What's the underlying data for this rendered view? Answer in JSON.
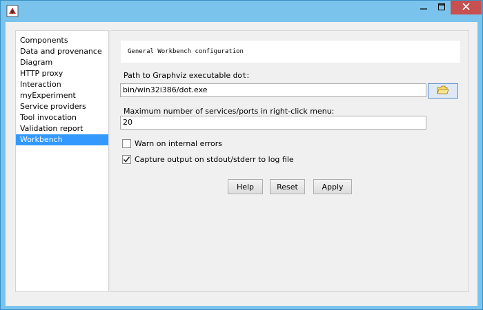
{
  "window": {
    "app_icon": "java-app-icon",
    "controls": [
      "minimize-icon",
      "maximize-icon",
      "close-icon"
    ]
  },
  "sidebar": {
    "items": [
      {
        "label": "Components"
      },
      {
        "label": "Data and provenance"
      },
      {
        "label": "Diagram"
      },
      {
        "label": "HTTP proxy"
      },
      {
        "label": "Interaction"
      },
      {
        "label": "myExperiment"
      },
      {
        "label": "Service providers"
      },
      {
        "label": "Tool invocation"
      },
      {
        "label": "Validation report"
      },
      {
        "label": "Workbench"
      }
    ],
    "selected": "Workbench",
    "selected_color": "#3399ff"
  },
  "workbench": {
    "header": "General Workbench configuration",
    "path_label": "Path to Graphviz executable ",
    "path_label_code": "dot",
    "path_label_suffix": ":",
    "path_value": "bin/win32i386/dot.exe",
    "browse_icon": "folder-open-icon",
    "max_label": "Maximum number of services/ports in right-click menu:",
    "max_value": "20",
    "warn_label": "Warn on internal errors",
    "warn_checked": false,
    "capture_label": "Capture output on stdout/stderr to log file",
    "capture_checked": true
  },
  "buttons": {
    "help": "Help",
    "reset": "Reset",
    "apply": "Apply"
  },
  "colors": {
    "titlebar": "#7ac3ec",
    "close": "#c75050"
  }
}
